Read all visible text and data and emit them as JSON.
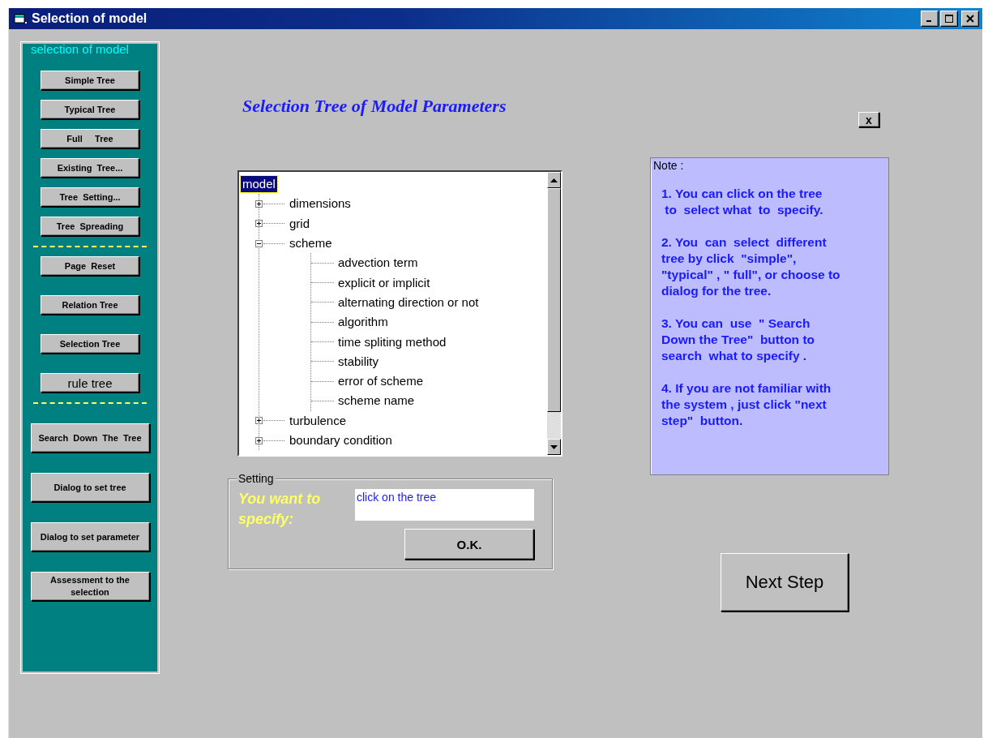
{
  "window": {
    "title": "Selection of model"
  },
  "sidebar": {
    "legend": "selection of model",
    "groups": [
      {
        "buttons": [
          "Simple Tree",
          "Typical Tree",
          "Full     Tree",
          "Existing  Tree...",
          "Tree  Setting...",
          "Tree  Spreading"
        ]
      },
      {
        "buttons": [
          "Page  Reset",
          "Relation Tree",
          "Selection Tree",
          "rule tree"
        ]
      },
      {
        "buttons": [
          "Search  Down  The  Tree",
          "Dialog to set tree",
          "Dialog to set parameter",
          "Assessment to the selection"
        ]
      }
    ]
  },
  "heading": "Selection Tree of Model Parameters",
  "close_button": "x",
  "tree": {
    "root": {
      "label": "model",
      "selected": true,
      "children": [
        {
          "label": "dimensions",
          "selected": false,
          "expanded": false
        },
        {
          "label": "grid",
          "selected": false,
          "expanded": false
        },
        {
          "label": "scheme",
          "selected": false,
          "expanded": true,
          "children": [
            {
              "label": "advection term",
              "selected": false
            },
            {
              "label": "explicit or implicit",
              "selected": false
            },
            {
              "label": "alternating direction or not",
              "selected": false
            },
            {
              "label": "algorithm",
              "selected": false
            },
            {
              "label": "time spliting method",
              "selected": false
            },
            {
              "label": "stability",
              "selected": false
            },
            {
              "label": "error of scheme",
              "selected": false
            },
            {
              "label": "scheme name",
              "selected": false
            }
          ]
        },
        {
          "label": "turbulence",
          "selected": false,
          "expanded": false
        },
        {
          "label": "boundary condition",
          "selected": false,
          "expanded": false
        }
      ]
    }
  },
  "setting": {
    "legend": "Setting",
    "label": "You want to specify:",
    "field": {
      "value": "click on the tree"
    },
    "ok_button": "O.K."
  },
  "note": {
    "legend": "Note :",
    "paragraphs": [
      "1. You can click on the tree\n to  select what  to  specify.",
      "2. You  can  select  different\ntree by click  \"simple\",\n\"typical\" , \" full\", or choose to\ndialog for the tree.",
      "3. You can  use  \" Search\nDown the Tree\"  button to\nsearch  what to specify .",
      "4. If you are not familiar with\nthe system , just click \"next\nstep\"  button."
    ]
  },
  "next_button": "Next Step"
}
